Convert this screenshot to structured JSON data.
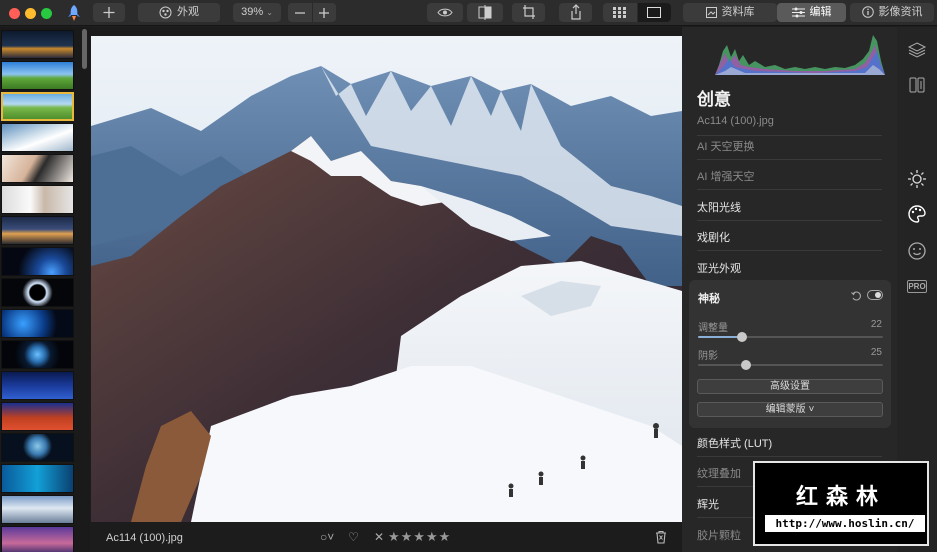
{
  "toolbar": {
    "appearance_label": "外观",
    "zoom_label": "39%",
    "tab_library": "资料库",
    "tab_edit": "编辑",
    "tab_info": "影像资讯"
  },
  "filmstrip": {
    "thumbnails": [
      "night-city",
      "green-hills",
      "green-field",
      "snow-mountain",
      "portrait-woman",
      "portrait-window",
      "city-skyline",
      "planet-blue",
      "eclipse-dark",
      "earth-blue",
      "earth-globe",
      "flying-person",
      "figures-red",
      "earth-small",
      "ocean-blue",
      "winter-mountains",
      "purple-sky"
    ],
    "selected_index": 2
  },
  "photo": {
    "filename": "Ac114 (100).jpg",
    "rating": "★★★★★"
  },
  "panel": {
    "title": "创意",
    "filename": "Ac114 (100).jpg",
    "items_top": [
      "AI 天空更换",
      "AI 增强天空",
      "太阳光线",
      "戏剧化",
      "亚光外观"
    ],
    "items_top_dim": [
      true,
      true,
      false,
      false,
      false
    ],
    "card": {
      "title": "神秘",
      "slider1_label": "调整量",
      "slider1_value": "22",
      "slider2_label": "阴影",
      "slider2_value": "25",
      "btn_advanced": "高级设置",
      "btn_mask": "编辑蒙版 ˅"
    },
    "items_bottom": [
      "颜色样式 (LUT)",
      "纹理叠加",
      "辉光",
      "胶片颗粒"
    ],
    "items_bottom_dim": [
      false,
      true,
      false,
      true
    ]
  },
  "rail": {
    "pro_label": "PRO"
  },
  "watermark": {
    "title": "红森林",
    "url": "http://www.hoslin.cn/"
  },
  "colors": {
    "accent_yellow": "#e8b93b",
    "slider_fill": "#8ab0d8",
    "close": "#ff5f57",
    "minimize": "#febc2e",
    "zoom": "#28c840"
  }
}
